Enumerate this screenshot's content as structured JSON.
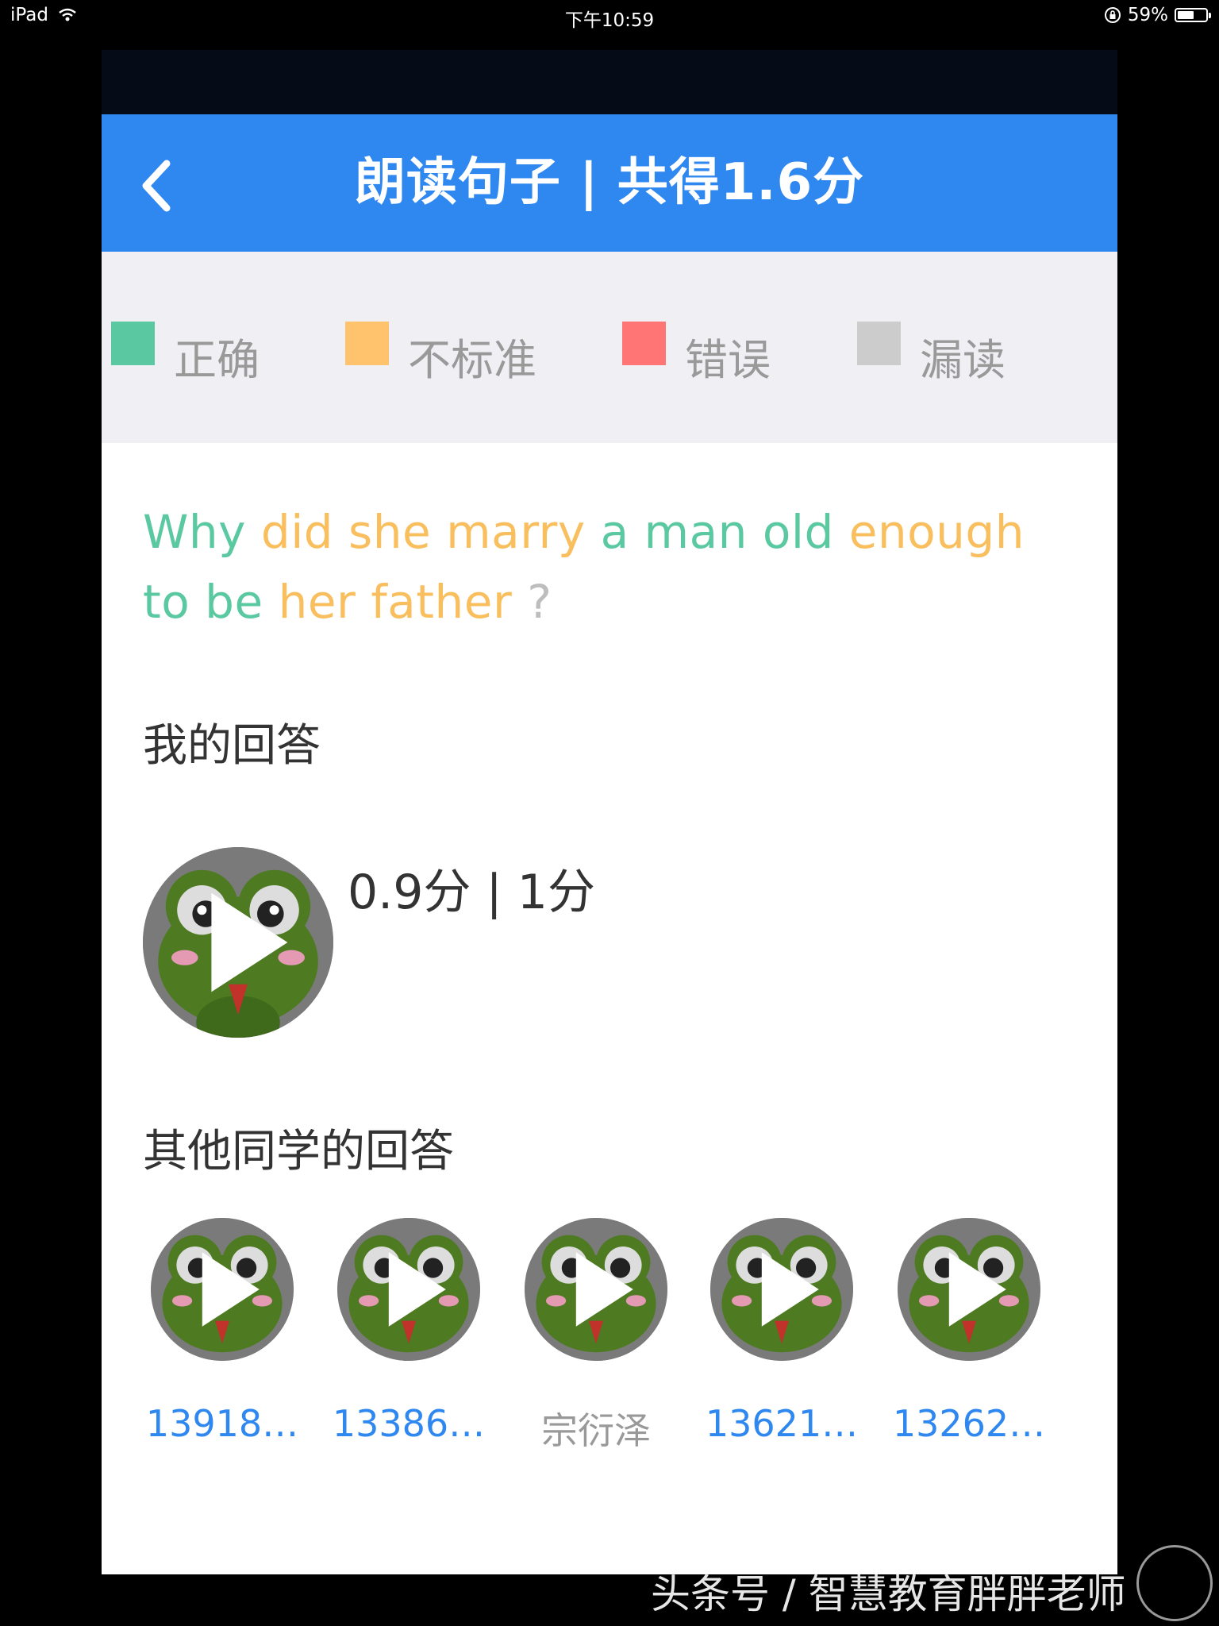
{
  "status_bar": {
    "device": "iPad",
    "time": "下午10:59",
    "battery": "59%",
    "battery_level": 0.59
  },
  "nav": {
    "title": "朗读句子 | 共得1.6分"
  },
  "legend": [
    {
      "label": "正确",
      "color": "#5ac9a1"
    },
    {
      "label": "不标准",
      "color": "#ffc36e"
    },
    {
      "label": "错误",
      "color": "#ff7575"
    },
    {
      "label": "漏读",
      "color": "#cccccc"
    }
  ],
  "sentence": [
    {
      "text": "Why",
      "status": "correct"
    },
    {
      "text": "did she marry",
      "status": "nonstandard"
    },
    {
      "text": "a man old",
      "status": "correct"
    },
    {
      "text": "enough",
      "status": "nonstandard"
    },
    {
      "text": "to be",
      "status": "correct"
    },
    {
      "text": "her father",
      "status": "nonstandard"
    },
    {
      "text": "?",
      "status": "missed"
    }
  ],
  "my_answer": {
    "title": "我的回答",
    "score": "0.9分 | 1分"
  },
  "others": {
    "title": "其他同学的回答",
    "students": [
      {
        "name": "13918…",
        "is_link": true
      },
      {
        "name": "13386…",
        "is_link": true
      },
      {
        "name": "宗衍泽",
        "is_link": false
      },
      {
        "name": "13621…",
        "is_link": true
      },
      {
        "name": "13262…",
        "is_link": true
      }
    ]
  },
  "watermark": "头条号 / 智慧教育胖胖老师",
  "icons": {
    "back": "chevron-left-icon",
    "play": "play-icon",
    "avatar": "frog-avatar",
    "wifi": "wifi-icon",
    "lock": "orientation-lock-icon",
    "battery": "battery-icon"
  }
}
